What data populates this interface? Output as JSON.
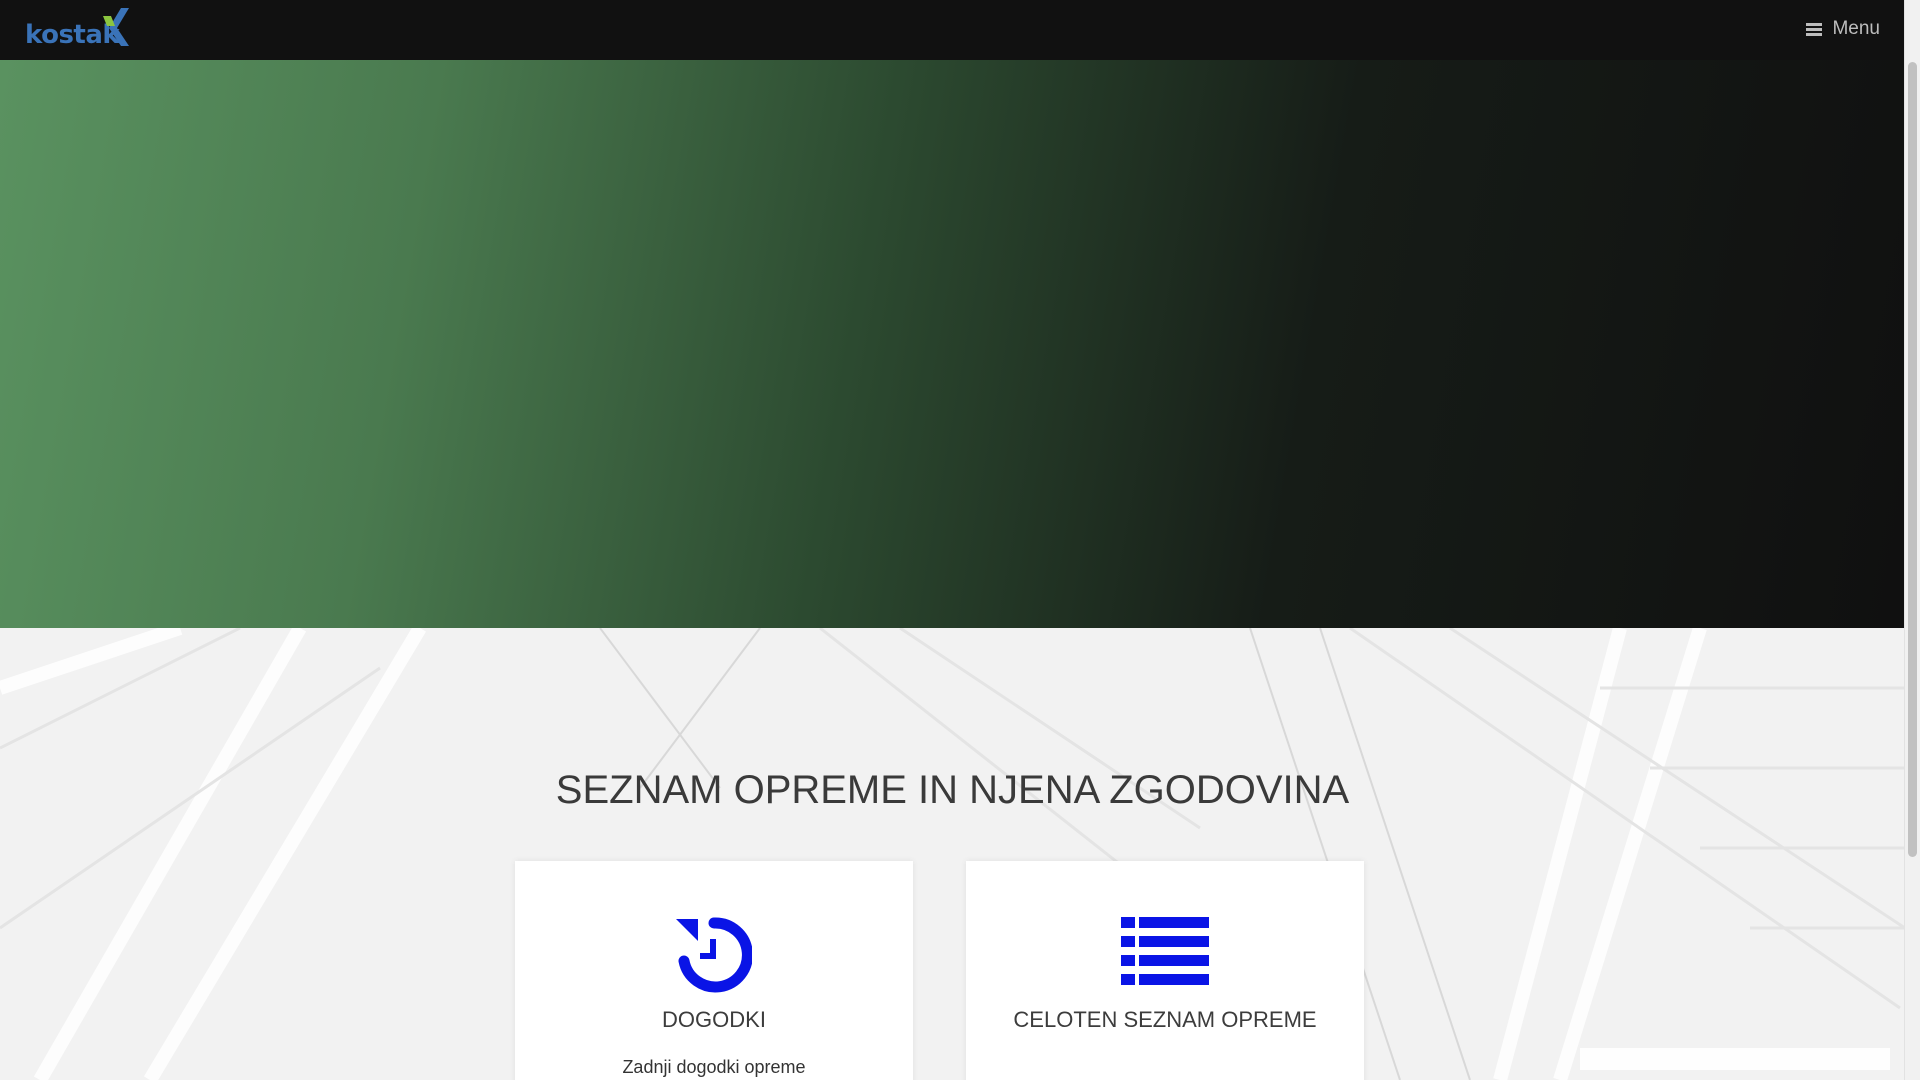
{
  "header": {
    "logo_text": "kostak",
    "menu_label": "Menu"
  },
  "main": {
    "title": "SEZNAM OPREME IN NJENA ZGODOVINA",
    "cards": [
      {
        "icon": "history-icon",
        "title": "DOGODKI",
        "description": "Zadnji dogodki opreme"
      },
      {
        "icon": "list-icon",
        "title": "CELOTEN SEZNAM OPREME",
        "description": ""
      }
    ]
  },
  "colors": {
    "icon_blue": "#0a14e6",
    "logo_blue": "#3a73b8",
    "logo_green": "#8cc63f"
  }
}
